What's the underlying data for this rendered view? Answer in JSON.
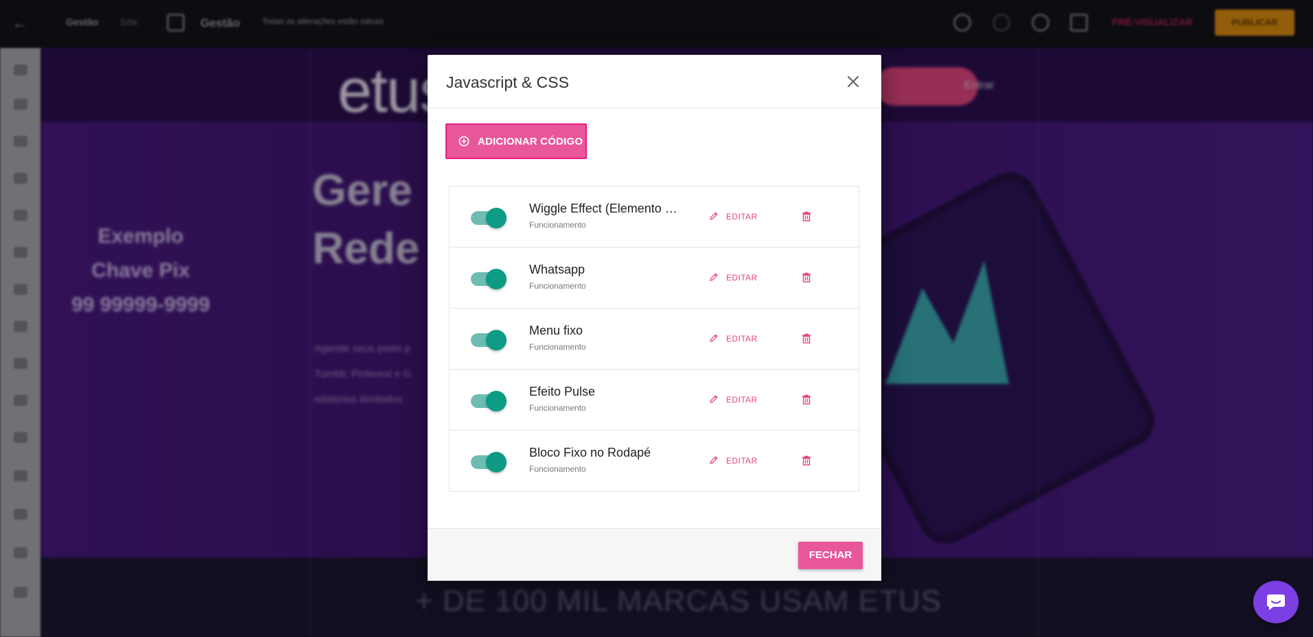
{
  "editor": {
    "topbar": {
      "menu_item_1": "Gestão",
      "menu_item_2": "Site",
      "page_name": "Gestão",
      "save_status": "Todas as alterações estão salvas",
      "preview_label": "PRÉ-VISUALIZAR",
      "publish_label": "PUBLICAR"
    },
    "canvas": {
      "logo": "etus",
      "login_link": "Entrar",
      "example_text": [
        "Exemplo",
        "Chave Pix",
        "99 99999-9999"
      ],
      "headline_lines": [
        "Gere",
        "Rede"
      ],
      "paragraph_lines": [
        "Agende seus posts p",
        "Tumblr, Pinterest e G",
        "relatórios ilimitados"
      ],
      "footer_banner": "+ DE 100 MIL MARCAS USAM ETUS"
    }
  },
  "modal": {
    "title": "Javascript & CSS",
    "add_button_label": "ADICIONAR CÓDIGO",
    "items": [
      {
        "name": "Wiggle Effect (Elemento Flutuante)",
        "status": "Funcionamento",
        "enabled": true,
        "edit_label": "EDITAR"
      },
      {
        "name": "Whatsapp",
        "status": "Funcionamento",
        "enabled": true,
        "edit_label": "EDITAR"
      },
      {
        "name": "Menu fixo",
        "status": "Funcionamento",
        "enabled": true,
        "edit_label": "EDITAR"
      },
      {
        "name": "Efeito Pulse",
        "status": "Funcionamento",
        "enabled": true,
        "edit_label": "EDITAR"
      },
      {
        "name": "Bloco Fixo no Rodapé",
        "status": "Funcionamento",
        "enabled": true,
        "edit_label": "EDITAR"
      }
    ],
    "close_button_label": "FECHAR"
  },
  "colors": {
    "accent_pink": "#e8579a",
    "toggle_on": "#0e9b84",
    "chat_purple": "#7b3fe4"
  },
  "icons": {
    "close": "close-icon",
    "add": "plus-circle-icon",
    "edit": "pencil-icon",
    "delete": "trash-icon",
    "chat": "chat-icon"
  }
}
